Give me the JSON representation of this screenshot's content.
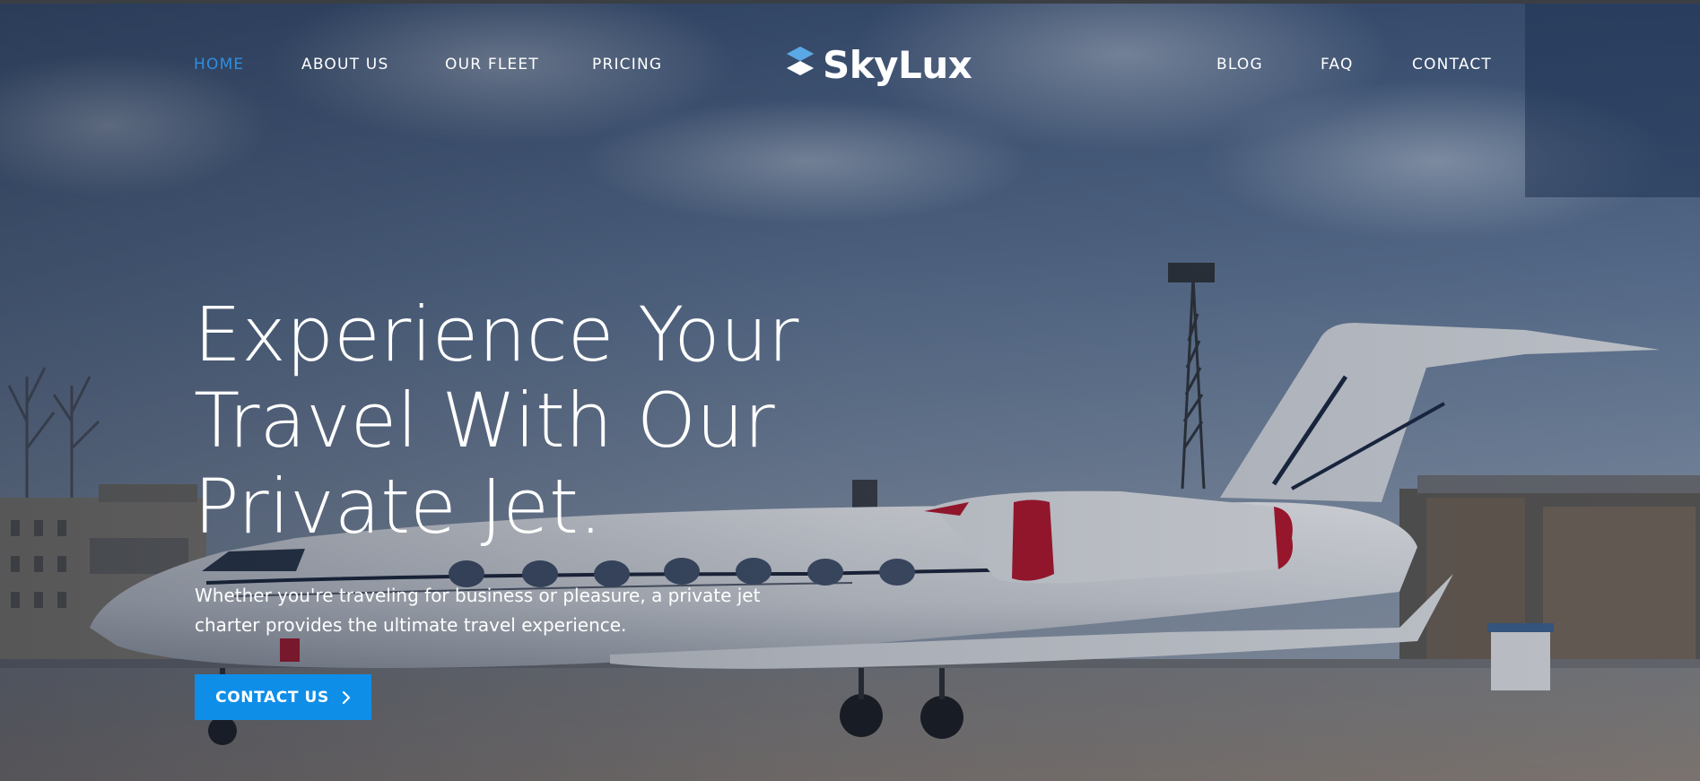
{
  "colors": {
    "accent": "#0f8ee8",
    "nav_active": "#2f8fe0",
    "text": "#ffffff"
  },
  "nav": {
    "left": [
      {
        "label": "HOME",
        "active": true
      },
      {
        "label": "ABOUT US",
        "active": false
      },
      {
        "label": "OUR FLEET",
        "active": false
      },
      {
        "label": "PRICING",
        "active": false
      }
    ],
    "right": [
      {
        "label": "BLOG",
        "active": false
      },
      {
        "label": "FAQ",
        "active": false
      },
      {
        "label": "CONTACT",
        "active": false
      }
    ]
  },
  "logo": {
    "text": "SkyLux",
    "icon": "s-logo-icon"
  },
  "hero": {
    "title_lines": [
      "Experience Your",
      "Travel With Our",
      "Private Jet."
    ],
    "subtitle": "Whether you're traveling for business or pleasure, a private jet charter provides the ultimate travel experience.",
    "cta_label": "CONTACT US",
    "cta_icon": "chevron-right-icon",
    "background": "private-jet-on-tarmac-photo"
  }
}
